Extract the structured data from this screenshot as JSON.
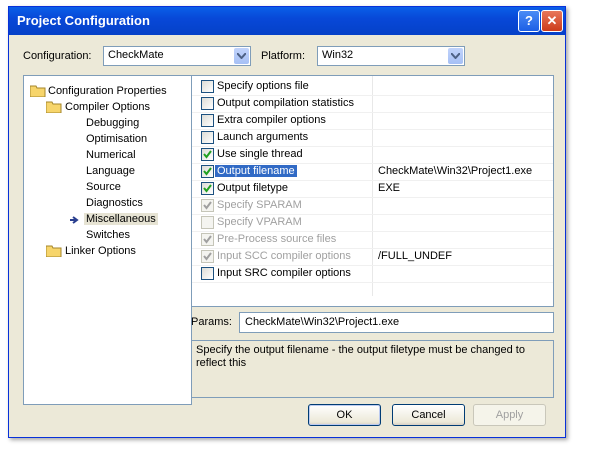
{
  "window": {
    "title": "Project Configuration"
  },
  "titlebar": {
    "help_glyph": "?",
    "close_glyph": "✕"
  },
  "header": {
    "configuration_label": "Configuration:",
    "configuration_value": "CheckMate",
    "platform_label": "Platform:",
    "platform_value": "Win32"
  },
  "tree": {
    "root": "Configuration Properties",
    "compiler": "Compiler Options",
    "children": [
      "Debugging",
      "Optimisation",
      "Numerical",
      "Language",
      "Source",
      "Diagnostics",
      "Miscellaneous",
      "Switches"
    ],
    "linker": "Linker Options",
    "selected": "Miscellaneous"
  },
  "options": [
    {
      "label": "Specify options file",
      "checked": false,
      "disabled": false,
      "value": ""
    },
    {
      "label": "Output compilation statistics",
      "checked": false,
      "disabled": false,
      "value": ""
    },
    {
      "label": "Extra compiler options",
      "checked": false,
      "disabled": false,
      "value": ""
    },
    {
      "label": "Launch arguments",
      "checked": false,
      "disabled": false,
      "value": ""
    },
    {
      "label": "Use single thread",
      "checked": true,
      "disabled": false,
      "value": ""
    },
    {
      "label": "Output filename",
      "checked": true,
      "disabled": false,
      "value": "CheckMate\\Win32\\Project1.exe",
      "selected": true
    },
    {
      "label": "Output filetype",
      "checked": true,
      "disabled": false,
      "value": "EXE"
    },
    {
      "label": "Specify SPARAM",
      "checked": true,
      "disabled": true,
      "value": ""
    },
    {
      "label": "Specify VPARAM",
      "checked": false,
      "disabled": true,
      "value": ""
    },
    {
      "label": "Pre-Process source files",
      "checked": true,
      "disabled": true,
      "value": ""
    },
    {
      "label": "Input SCC compiler options",
      "checked": true,
      "disabled": true,
      "value": "/FULL_UNDEF"
    },
    {
      "label": "Input SRC compiler options",
      "checked": false,
      "disabled": false,
      "value": ""
    }
  ],
  "params": {
    "label": "Params:",
    "value": "CheckMate\\Win32\\Project1.exe"
  },
  "description": "Specify the output filename - the output filetype must be changed to reflect this",
  "buttons": {
    "ok": "OK",
    "cancel": "Cancel",
    "apply": "Apply"
  }
}
